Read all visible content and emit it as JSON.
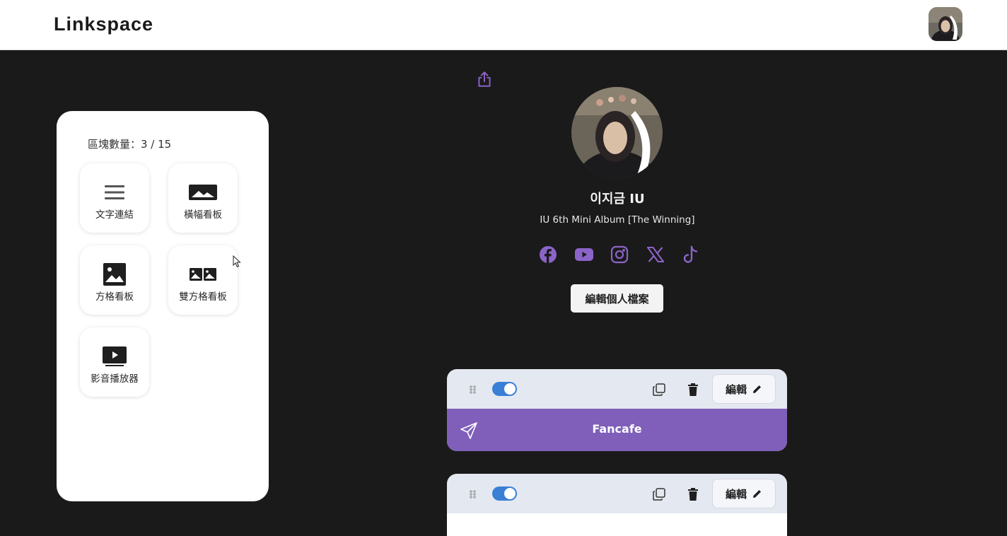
{
  "header": {
    "logo": "Linkspace",
    "avatar_icon": "user-avatar"
  },
  "panel": {
    "count_label": "區塊數量：3 / 15",
    "tiles": [
      {
        "label": "文字連結",
        "icon": "text-lines-icon"
      },
      {
        "label": "橫幅看板",
        "icon": "banner-image-icon"
      },
      {
        "label": "方格看板",
        "icon": "square-image-icon"
      },
      {
        "label": "雙方格看板",
        "icon": "double-image-icon"
      },
      {
        "label": "影音播放器",
        "icon": "video-player-icon"
      }
    ]
  },
  "profile": {
    "name": "이지금 IU",
    "bio": "IU 6th Mini Album [The Winning]",
    "edit_button": "編輯個人檔案",
    "socials": [
      "facebook",
      "youtube",
      "instagram",
      "x",
      "tiktok"
    ]
  },
  "blocks": [
    {
      "edit_label": "編輯",
      "enabled": true,
      "link_text": "Fancafe"
    },
    {
      "edit_label": "編輯",
      "enabled": true
    }
  ],
  "colors": {
    "accent": "#7f5fba",
    "toggle": "#3a7fd5",
    "background": "#1a1a1a",
    "block_bar": "#e4e8f0"
  }
}
